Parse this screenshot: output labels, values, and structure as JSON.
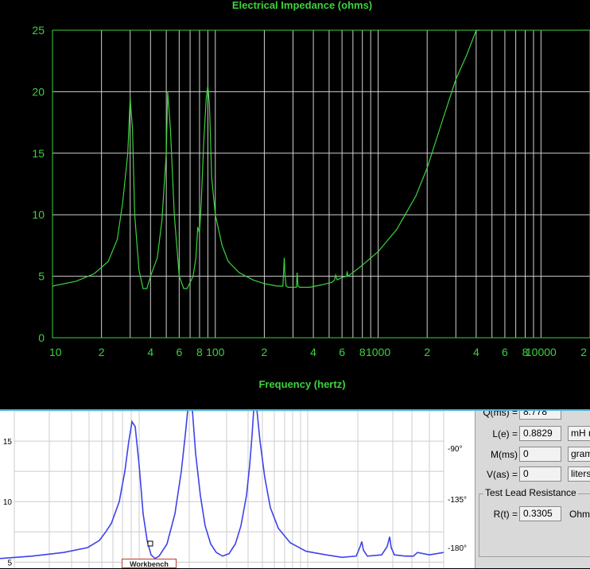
{
  "chart_data": [
    {
      "type": "line",
      "title": "Electrical Impedance (ohms)",
      "xlabel": "Frequency (hertz)",
      "ylabel": "",
      "x_scale": "log",
      "xlim": [
        10,
        20000
      ],
      "ylim": [
        0,
        25
      ],
      "y_ticks": [
        "0",
        "5",
        "10",
        "15",
        "20",
        "25"
      ],
      "x_ticks": [
        {
          "v": 10,
          "t": "10"
        },
        {
          "v": 20,
          "t": "2"
        },
        {
          "v": 40,
          "t": "4"
        },
        {
          "v": 60,
          "t": "6"
        },
        {
          "v": 80,
          "t": "8"
        },
        {
          "v": 100,
          "t": "100"
        },
        {
          "v": 200,
          "t": "2"
        },
        {
          "v": 400,
          "t": "4"
        },
        {
          "v": 600,
          "t": "6"
        },
        {
          "v": 800,
          "t": "8"
        },
        {
          "v": 1000,
          "t": "1000"
        },
        {
          "v": 2000,
          "t": "2"
        },
        {
          "v": 4000,
          "t": "4"
        },
        {
          "v": 6000,
          "t": "6"
        },
        {
          "v": 8000,
          "t": "8"
        },
        {
          "v": 10000,
          "t": "10000"
        },
        {
          "v": 20000,
          "t": "2"
        }
      ],
      "grid": true,
      "colors": {
        "background": "#000000",
        "grid": "#d0d0d0",
        "frame": "#3cd23c",
        "line": "#3cd23c",
        "text": "#3cd23c"
      },
      "series": [
        {
          "x": [
            10,
            14,
            18,
            22,
            25,
            27,
            29,
            30,
            31,
            32,
            34,
            36,
            38,
            40,
            44,
            47,
            50,
            51,
            53,
            56,
            60,
            64,
            67,
            70,
            73,
            76,
            78,
            80,
            82,
            85,
            88,
            90,
            92,
            95,
            100,
            110,
            120,
            140,
            170,
            200,
            240,
            260,
            265,
            268,
            272,
            280,
            300,
            315,
            318,
            322,
            330,
            380,
            450,
            520,
            540,
            548,
            560,
            600,
            640,
            645,
            652,
            700,
            800,
            1000,
            1300,
            1700,
            2000,
            2500,
            3000,
            3500,
            4000,
            4200
          ],
          "y": [
            4.2,
            4.6,
            5.2,
            6.2,
            8.0,
            11.0,
            15.0,
            19.5,
            17.0,
            10.0,
            5.5,
            4.0,
            4.0,
            5.0,
            6.5,
            9.5,
            15.0,
            20.0,
            17.0,
            10.0,
            5.0,
            4.0,
            4.0,
            4.5,
            5.0,
            6.5,
            9.0,
            8.5,
            11.0,
            16.0,
            19.5,
            20.5,
            19.0,
            13.0,
            10.0,
            7.5,
            6.2,
            5.3,
            4.7,
            4.4,
            4.2,
            4.2,
            6.5,
            5.0,
            4.2,
            4.1,
            4.1,
            4.1,
            5.3,
            4.2,
            4.1,
            4.1,
            4.3,
            4.5,
            4.7,
            5.1,
            4.7,
            4.9,
            5.0,
            5.4,
            5.0,
            5.3,
            5.9,
            7.0,
            8.8,
            11.5,
            13.8,
            17.8,
            21.0,
            23.0,
            25.0,
            25.2
          ]
        }
      ]
    },
    {
      "type": "line",
      "title": "",
      "xlabel": "",
      "ylabel": "",
      "ylim": [
        4.5,
        17.5
      ],
      "y_ticks": [
        "5",
        "10",
        "15"
      ],
      "right_ticks": [
        "-90°",
        "-135°",
        "-180°"
      ],
      "grid": true,
      "colors": {
        "background": "#ffffff",
        "grid": "#cccccc",
        "line": "#3d43e8",
        "text": "#000000"
      },
      "series": [
        {
          "x": [
            0,
            40,
            80,
            110,
            125,
            133,
            140,
            150,
            157,
            162,
            166,
            170,
            175,
            180,
            185,
            190,
            195,
            200,
            210,
            220,
            228,
            233,
            236,
            238,
            240,
            242,
            246,
            252,
            258,
            265,
            272,
            280,
            288,
            296,
            303,
            310,
            314,
            317,
            319,
            321,
            323,
            327,
            333,
            340,
            350,
            365,
            385,
            410,
            430,
            448,
            453,
            455,
            457,
            462,
            480,
            487,
            490,
            492,
            496,
            510,
            520,
            525,
            540,
            558
          ],
          "y": [
            5.3,
            5.5,
            5.8,
            6.2,
            6.8,
            7.5,
            8.2,
            10.0,
            12.5,
            15.0,
            16.6,
            16.2,
            13.0,
            9.0,
            6.8,
            5.6,
            5.3,
            5.5,
            6.5,
            9.0,
            12.5,
            15.5,
            17.5,
            19.0,
            19.0,
            17.5,
            14.0,
            10.5,
            8.0,
            6.5,
            5.8,
            5.5,
            5.7,
            6.5,
            8.0,
            10.5,
            13.0,
            15.5,
            17.5,
            19.0,
            18.0,
            15.0,
            12.0,
            9.5,
            7.8,
            6.6,
            5.9,
            5.6,
            5.4,
            5.5,
            6.3,
            6.7,
            6.0,
            5.5,
            5.6,
            6.3,
            7.1,
            6.2,
            5.6,
            5.5,
            5.5,
            5.8,
            5.6,
            5.8
          ]
        }
      ]
    }
  ],
  "workbench_label": "Workbench",
  "params": {
    "qms_label": "Q(ms) =",
    "qms_value": "8.778",
    "le_label": "L(e) =",
    "le_value": "0.8829",
    "le_unit": "mH r",
    "mms_label": "M(ms)",
    "mms_value": "0",
    "mms_unit": "gram",
    "vas_label": "V(as) =",
    "vas_value": "0",
    "vas_unit": "liters",
    "test_lead_title": "Test Lead Resistance",
    "rt_label": "R(t) =",
    "rt_value": "0.3305",
    "rt_unit": "Ohm"
  }
}
